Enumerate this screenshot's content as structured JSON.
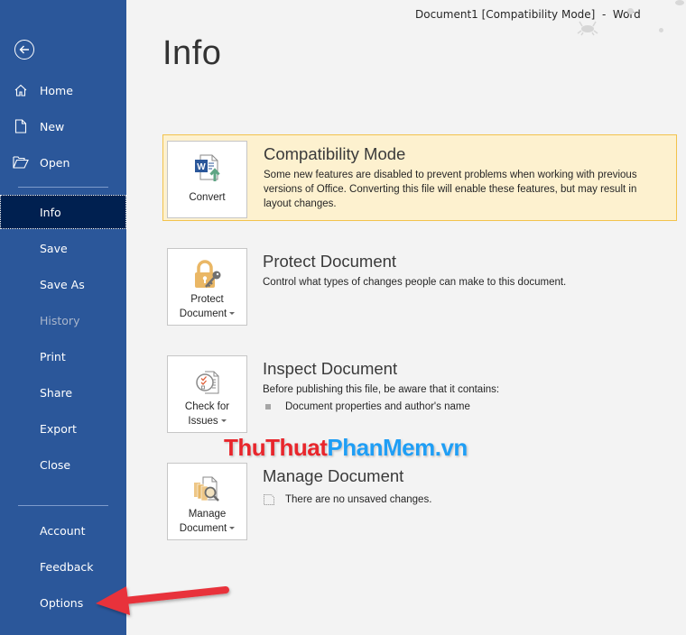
{
  "window": {
    "title": "Document1 [Compatibility Mode]  -  Word"
  },
  "sidebar": {
    "back_label": "Back",
    "items": [
      {
        "label": "Home",
        "icon": "home-icon"
      },
      {
        "label": "New",
        "icon": "new-document-icon"
      },
      {
        "label": "Open",
        "icon": "open-folder-icon"
      },
      {
        "label": "Info",
        "active": true
      },
      {
        "label": "Save"
      },
      {
        "label": "Save As"
      },
      {
        "label": "History",
        "disabled": true
      },
      {
        "label": "Print"
      },
      {
        "label": "Share"
      },
      {
        "label": "Export"
      },
      {
        "label": "Close"
      },
      {
        "label": "Account"
      },
      {
        "label": "Feedback"
      },
      {
        "label": "Options"
      }
    ]
  },
  "main": {
    "title": "Info",
    "sections": [
      {
        "button_label": "Convert",
        "heading": "Compatibility Mode",
        "description": "Some new features are disabled to prevent problems when working with previous versions of Office. Converting this file will enable these features, but may result in layout changes."
      },
      {
        "button_label_line1": "Protect",
        "button_label_line2": "Document",
        "heading": "Protect Document",
        "description": "Control what types of changes people can make to this document."
      },
      {
        "button_label_line1": "Check for",
        "button_label_line2": "Issues",
        "heading": "Inspect Document",
        "description": "Before publishing this file, be aware that it contains:",
        "bullets": [
          "Document properties and author's name"
        ]
      },
      {
        "button_label_line1": "Manage",
        "button_label_line2": "Document",
        "heading": "Manage Document",
        "status": "There are no unsaved changes."
      }
    ]
  },
  "watermark": {
    "part1": "ThuThuat",
    "part2": "PhanMem.vn"
  },
  "colors": {
    "sidebar_bg": "#2b579a",
    "sidebar_active": "#002050",
    "warning_bg": "#fdf1cf",
    "warning_border": "#f2c34c",
    "annotation_arrow": "#e8323a"
  }
}
